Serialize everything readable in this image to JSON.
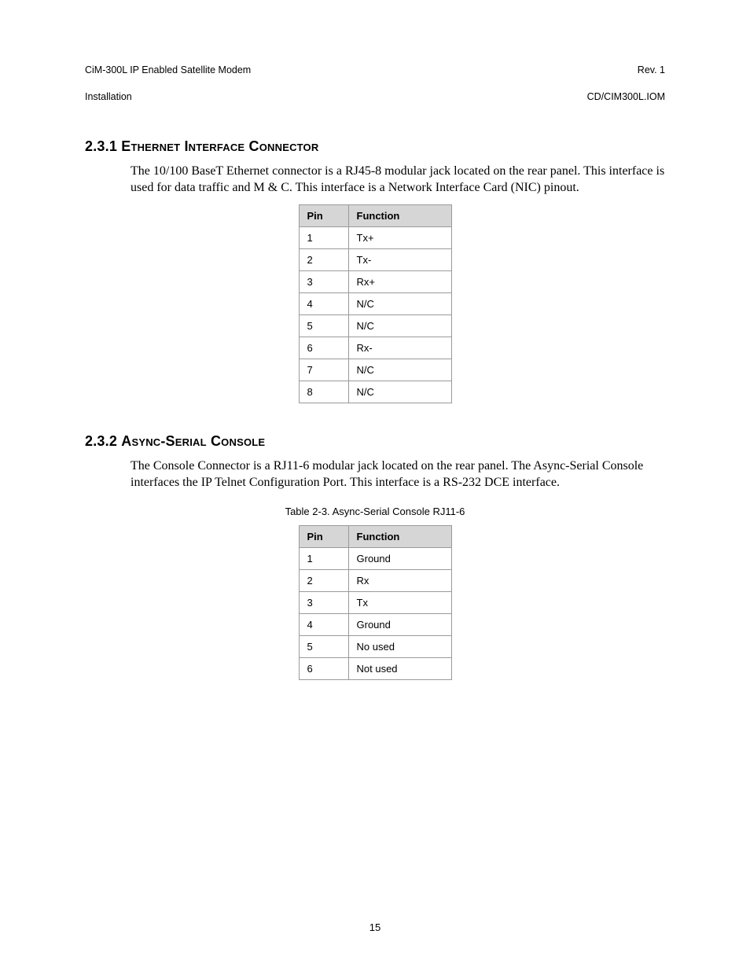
{
  "header": {
    "left_line1": "CiM-300L IP Enabled Satellite Modem",
    "left_line2": "Installation",
    "right_line1": "Rev. 1",
    "right_line2": "CD/CIM300L.IOM"
  },
  "sections": [
    {
      "number": "2.3.1",
      "title": "Ethernet Interface Connector",
      "paragraph": "The 10/100 BaseT Ethernet connector is a RJ45-8 modular jack located on the rear panel. This interface is used for data traffic and M & C. This interface is a Network Interface Card (NIC) pinout.",
      "table": {
        "headers": [
          "Pin",
          "Function"
        ],
        "rows": [
          [
            "1",
            "Tx+"
          ],
          [
            "2",
            "Tx-"
          ],
          [
            "3",
            "Rx+"
          ],
          [
            "4",
            "N/C"
          ],
          [
            "5",
            "N/C"
          ],
          [
            "6",
            "Rx-"
          ],
          [
            "7",
            "N/C"
          ],
          [
            "8",
            "N/C"
          ]
        ]
      }
    },
    {
      "number": "2.3.2",
      "title": "Async-Serial Console",
      "paragraph": "The Console Connector is a RJ11-6 modular jack located on the rear panel. The Async-Serial Console interfaces the IP Telnet Configuration Port. This interface is a RS-232 DCE interface.",
      "caption": "Table 2-3.  Async-Serial Console RJ11-6",
      "table": {
        "headers": [
          "Pin",
          "Function"
        ],
        "rows": [
          [
            "1",
            "Ground"
          ],
          [
            "2",
            "Rx"
          ],
          [
            "3",
            "Tx"
          ],
          [
            "4",
            "Ground"
          ],
          [
            "5",
            "No used"
          ],
          [
            "6",
            "Not used"
          ]
        ]
      }
    }
  ],
  "page_number": "15"
}
